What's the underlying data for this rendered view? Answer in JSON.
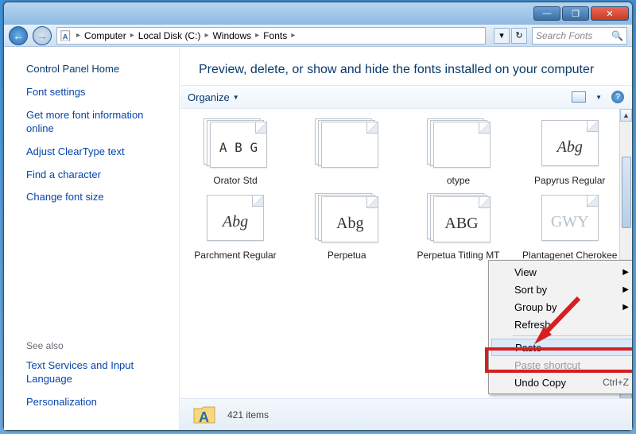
{
  "window": {
    "minimize": "—",
    "maximize": "❐",
    "close": "✕"
  },
  "breadcrumbs": [
    "Computer",
    "Local Disk (C:)",
    "Windows",
    "Fonts"
  ],
  "search": {
    "placeholder": "Search Fonts"
  },
  "sidebar": {
    "heading": "Control Panel Home",
    "links": [
      "Font settings",
      "Get more font information online",
      "Adjust ClearType text",
      "Find a character",
      "Change font size"
    ],
    "seealso_label": "See also",
    "seealso": [
      "Text Services and Input Language",
      "Personalization"
    ]
  },
  "main": {
    "header": "Preview, delete, or show and hide the fonts installed on your computer",
    "organize": "Organize"
  },
  "fonts": {
    "row1": [
      {
        "name": "Orator Std",
        "sample": "A B G",
        "stack": true,
        "font": "monospace",
        "size": "16px"
      },
      {
        "name": "",
        "sample": "",
        "stack": true
      },
      {
        "name": "otype",
        "sample": "",
        "stack": true,
        "partial": true
      },
      {
        "name": "Papyrus Regular",
        "sample": "Abg",
        "stack": false,
        "font": "'Papyrus',serif",
        "style": "italic"
      }
    ],
    "row2": [
      {
        "name": "Parchment Regular",
        "sample": "Abg",
        "stack": false,
        "font": "cursive",
        "style": "italic"
      },
      {
        "name": "Perpetua",
        "sample": "Abg",
        "stack": true,
        "font": "serif"
      },
      {
        "name": "Perpetua Titling MT",
        "sample": "ABG",
        "stack": true,
        "font": "serif"
      },
      {
        "name": "Plantagenet Cherokee Regular",
        "sample": "GWY",
        "stack": false,
        "font": "serif",
        "color": "#b8c0c8"
      }
    ]
  },
  "context_menu": {
    "view": "View",
    "sortby": "Sort by",
    "groupby": "Group by",
    "refresh": "Refresh",
    "paste": "Paste",
    "paste_shortcut": "Paste shortcut",
    "undo_copy": "Undo Copy",
    "undo_shortcut": "Ctrl+Z"
  },
  "status": {
    "count": "421 items"
  }
}
